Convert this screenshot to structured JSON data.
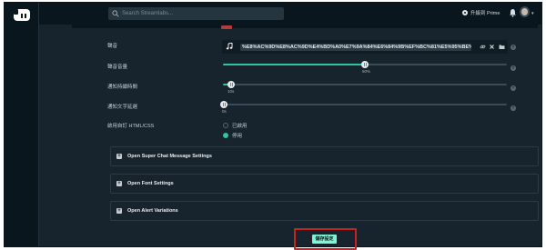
{
  "app": {
    "search_placeholder": "Search Streamlabs...",
    "prime_label": "升級到 Prime",
    "avatar_caret": "▾"
  },
  "settings": {
    "sound": {
      "label": "聲音",
      "url": "%E8%AC%9D%E8%AC%9D%E4%BD%A0%E7%9A%84%E6%84%9B%EF%BC%81%E5%95%BE%E5%92%AA.m..."
    },
    "volume": {
      "label": "聲音音量",
      "value": "50%",
      "percent": 50
    },
    "alert_duration": {
      "label": "通知持續時間",
      "value": "10s",
      "fraction": 0.03
    },
    "text_delay": {
      "label": "通知文字延遲",
      "value": "0s",
      "fraction": 0.0
    },
    "custom_html": {
      "label": "啟用自訂 HTML/CSS",
      "options": [
        "已啟用",
        "停用"
      ],
      "selected": "停用"
    }
  },
  "sections": [
    {
      "title": "Open Super Chat Message Settings"
    },
    {
      "title": "Open Font Settings"
    },
    {
      "title": "Open Alert Variations"
    }
  ],
  "footer": {
    "save_label": "儲存設定"
  },
  "colors": {
    "accent": "#31c3a2",
    "save_button": "#80f5d2",
    "highlight": "#c8211f",
    "background": "#17242d"
  }
}
